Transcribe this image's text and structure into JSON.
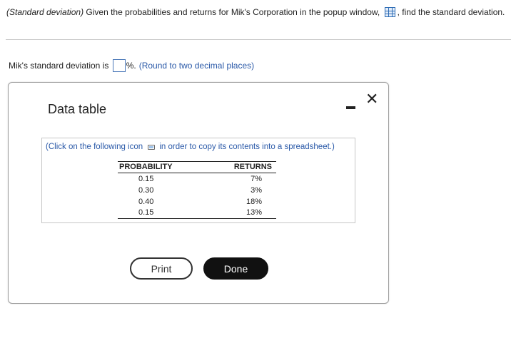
{
  "question": {
    "label_italic": "(Standard deviation)",
    "text_before_icon": " Given the probabilities and returns for Mik's Corporation in the popup window, ",
    "text_after_icon": ", find the standard deviation.",
    "icon": "spreadsheet-grid-icon"
  },
  "answer": {
    "prefix": "Mik's standard deviation is ",
    "input_value": "",
    "suffix": "%.",
    "hint": "(Round to two decimal places)"
  },
  "popup": {
    "title": "Data table",
    "minimize_icon": "minimize-icon",
    "close_icon": "close-icon",
    "close_glyph": "✕",
    "copy_note_before": "(Click on the following icon ",
    "copy_note_after": "in order to copy its contents into a spreadsheet.)",
    "copy_icon": "copy-icon",
    "table": {
      "headers": [
        "PROBABILITY",
        "RETURNS"
      ],
      "rows": [
        [
          "0.15",
          "7%"
        ],
        [
          "0.30",
          "3%"
        ],
        [
          "0.40",
          "18%"
        ],
        [
          "0.15",
          "13%"
        ]
      ]
    },
    "print_label": "Print",
    "done_label": "Done"
  }
}
